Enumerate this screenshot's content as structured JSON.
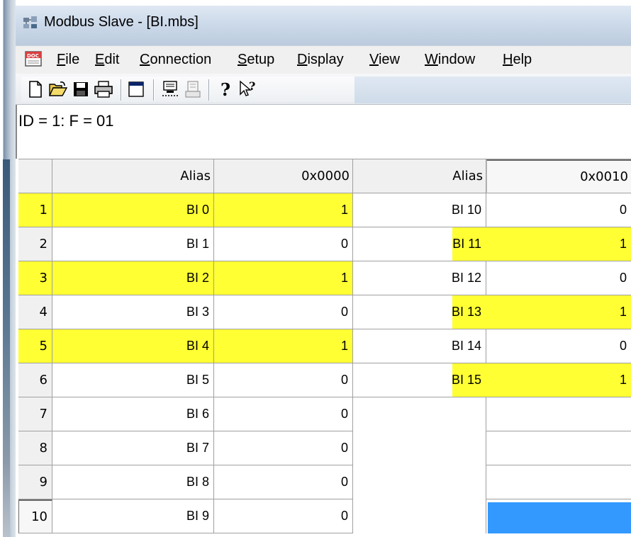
{
  "window": {
    "title": "Modbus Slave - [BI.mbs]"
  },
  "menu": [
    "File",
    "Edit",
    "Connection",
    "Setup",
    "Display",
    "View",
    "Window",
    "Help"
  ],
  "toolbar": {
    "buttons": [
      "new-icon",
      "open-icon",
      "save-icon",
      "print-icon",
      "window-icon",
      "connect-icon",
      "disconnect-icon",
      "about-icon",
      "context-help-icon"
    ]
  },
  "status_line": "ID = 1: F = 01",
  "grid": {
    "headers": [
      "Alias",
      "0x0000",
      "Alias",
      "0x0010"
    ],
    "rows": [
      {
        "num": "1",
        "alias1": "BI 0",
        "val1": "1",
        "alias2": "BI 10",
        "val2": "0"
      },
      {
        "num": "2",
        "alias1": "BI 1",
        "val1": "0",
        "alias2": "BI 11",
        "val2": "1"
      },
      {
        "num": "3",
        "alias1": "BI 2",
        "val1": "1",
        "alias2": "BI 12",
        "val2": "0"
      },
      {
        "num": "4",
        "alias1": "BI 3",
        "val1": "0",
        "alias2": "BI 13",
        "val2": "1"
      },
      {
        "num": "5",
        "alias1": "BI 4",
        "val1": "1",
        "alias2": "BI 14",
        "val2": "0"
      },
      {
        "num": "6",
        "alias1": "BI 5",
        "val1": "0",
        "alias2": "BI 15",
        "val2": "1"
      },
      {
        "num": "7",
        "alias1": "BI 6",
        "val1": "0",
        "alias2": "",
        "val2": ""
      },
      {
        "num": "8",
        "alias1": "BI 7",
        "val1": "0",
        "alias2": "",
        "val2": ""
      },
      {
        "num": "9",
        "alias1": "BI 8",
        "val1": "0",
        "alias2": "",
        "val2": ""
      },
      {
        "num": "10",
        "alias1": "BI 9",
        "val1": "0",
        "alias2": "",
        "val2": ""
      }
    ]
  },
  "colors": {
    "highlight": "#ffff33",
    "selection": "#3399ff"
  }
}
